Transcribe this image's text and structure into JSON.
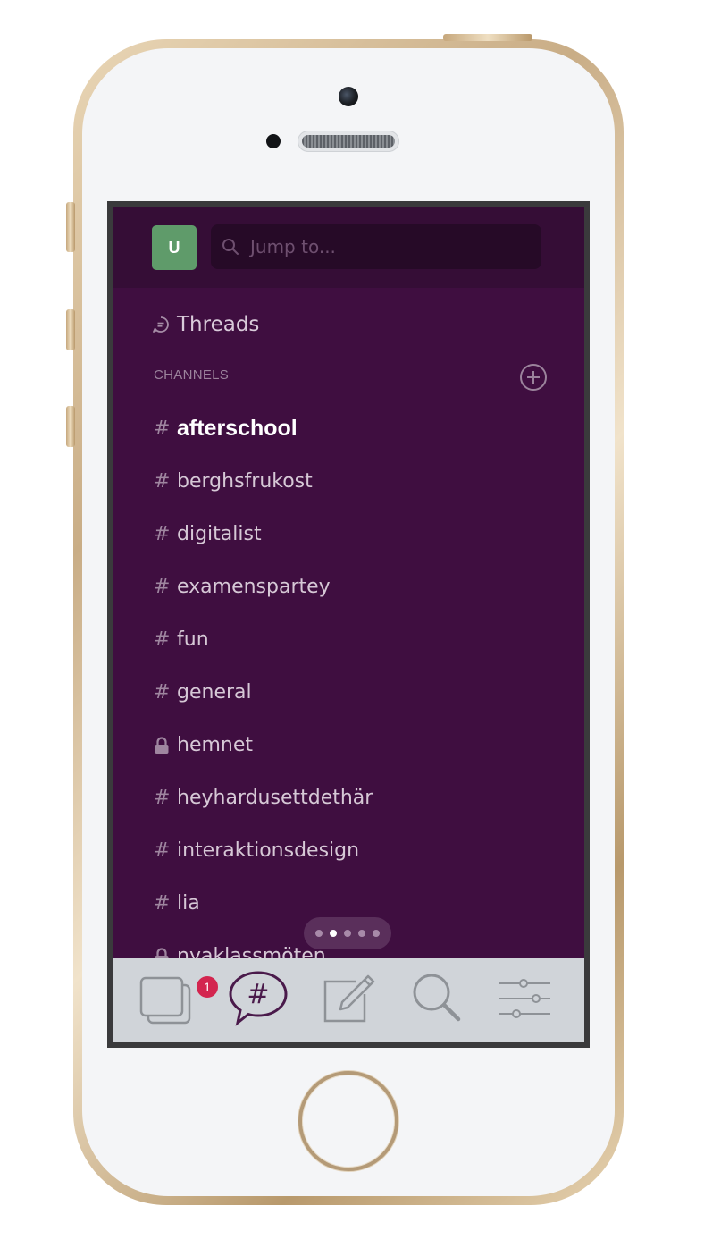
{
  "top_bar": {
    "avatar_initial": "U",
    "search_placeholder": "Jump to..."
  },
  "threads": {
    "label": "Threads"
  },
  "channels": {
    "header": "CHANNELS",
    "items": [
      {
        "name": "afterschool",
        "private": false,
        "active": true
      },
      {
        "name": "berghsfrukost",
        "private": false,
        "active": false
      },
      {
        "name": "digitalist",
        "private": false,
        "active": false
      },
      {
        "name": "examenspartey",
        "private": false,
        "active": false
      },
      {
        "name": "fun",
        "private": false,
        "active": false
      },
      {
        "name": "general",
        "private": false,
        "active": false
      },
      {
        "name": "hemnet",
        "private": true,
        "active": false
      },
      {
        "name": "heyhardusettdethär",
        "private": false,
        "active": false
      },
      {
        "name": "interaktionsdesign",
        "private": false,
        "active": false
      },
      {
        "name": "lia",
        "private": false,
        "active": false
      },
      {
        "name": "nyaklassmöten",
        "private": true,
        "active": false
      }
    ]
  },
  "channel_prefix": "#",
  "page_indicator": {
    "count": 5,
    "current": 1
  },
  "tab_bar": {
    "tabs": [
      {
        "icon": "workspaces-icon",
        "badge": "1"
      },
      {
        "icon": "channels-icon",
        "active": true
      },
      {
        "icon": "compose-icon"
      },
      {
        "icon": "search-icon"
      },
      {
        "icon": "settings-sliders-icon"
      }
    ]
  },
  "colors": {
    "sidebar_bg": "#3f0e40",
    "top_bar_bg": "#350d36",
    "avatar_bg": "#5f9b6a",
    "badge_bg": "#d3254f",
    "tab_bar_bg": "#d0d4d9"
  }
}
